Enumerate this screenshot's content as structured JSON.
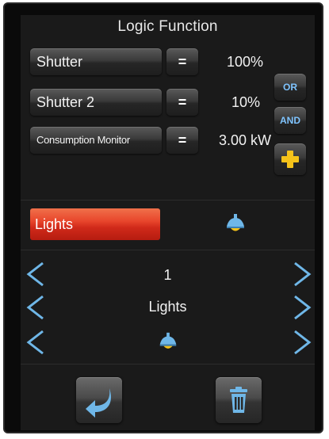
{
  "header": {
    "title": "Logic Function"
  },
  "conditions": [
    {
      "label": "Shutter",
      "operator": "=",
      "value": "100%"
    },
    {
      "label": "Shutter 2",
      "operator": "=",
      "value": "10%"
    },
    {
      "label": "Consumption Monitor",
      "operator": "=",
      "value": "3.00 kW"
    }
  ],
  "logic_buttons": {
    "or_label": "OR",
    "and_label": "AND"
  },
  "action": {
    "label": "Lights"
  },
  "selector": {
    "number": "1",
    "name": "Lights"
  },
  "colors": {
    "accent_red": "#d12a1a",
    "chevron_blue": "#6fb7e8",
    "plus_yellow": "#f4c21a"
  }
}
